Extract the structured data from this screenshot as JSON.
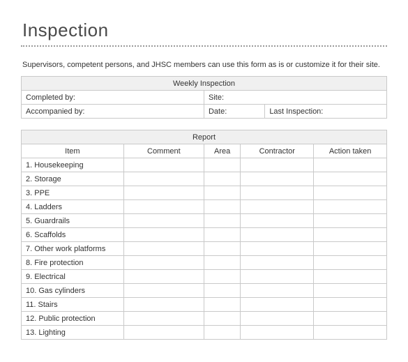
{
  "title": "Inspection",
  "intro": "Supervisors, competent persons, and JHSC members can use this form as is or customize it for their site.",
  "weekly": {
    "header": "Weekly Inspection",
    "completed_by_label": "Completed by:",
    "site_label": "Site:",
    "accompanied_by_label": "Accompanied by:",
    "date_label": "Date:",
    "last_inspection_label": "Last Inspection:"
  },
  "report": {
    "header": "Report",
    "columns": {
      "item": "Item",
      "comment": "Comment",
      "area": "Area",
      "contractor": "Contractor",
      "action": "Action taken"
    },
    "rows": [
      "1. Housekeeping",
      "2. Storage",
      "3. PPE",
      "4. Ladders",
      "5. Guardrails",
      "6. Scaffolds",
      "7. Other work platforms",
      "8. Fire protection",
      "9. Electrical",
      "10. Gas cylinders",
      "11. Stairs",
      "12. Public protection",
      "13. Lighting"
    ]
  }
}
